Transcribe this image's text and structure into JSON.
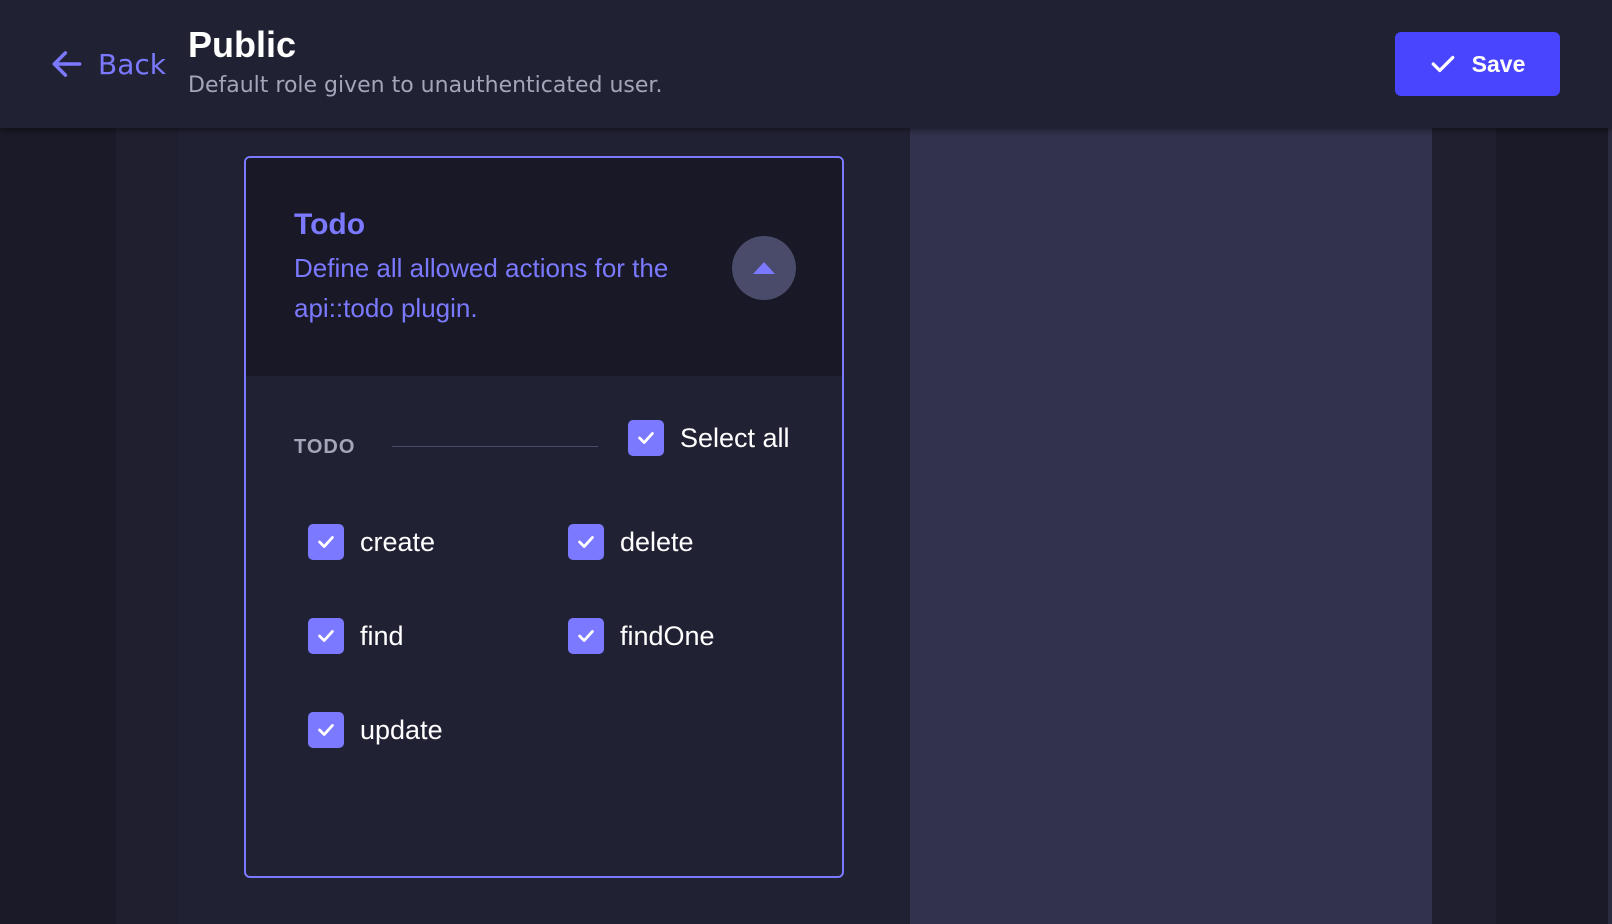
{
  "header": {
    "back_label": "Back",
    "title": "Public",
    "subtitle": "Default role given to unauthenticated user.",
    "save_label": "Save"
  },
  "plugin": {
    "title": "Todo",
    "description": "Define all allowed actions for the api::todo plugin.",
    "expanded": true
  },
  "section": {
    "label": "TODO",
    "select_all_label": "Select all",
    "select_all_checked": true,
    "permissions": [
      {
        "label": "create",
        "checked": true
      },
      {
        "label": "delete",
        "checked": true
      },
      {
        "label": "find",
        "checked": true
      },
      {
        "label": "findOne",
        "checked": true
      },
      {
        "label": "update",
        "checked": true
      }
    ]
  },
  "colors": {
    "accent": "#7b79ff",
    "primary_button": "#4945ff",
    "header_bg": "#212134",
    "card_head_bg": "#181826"
  },
  "icons": {
    "back": "arrow-left-icon",
    "save": "check-icon",
    "toggle": "caret-up-icon",
    "checkbox": "check-icon"
  }
}
